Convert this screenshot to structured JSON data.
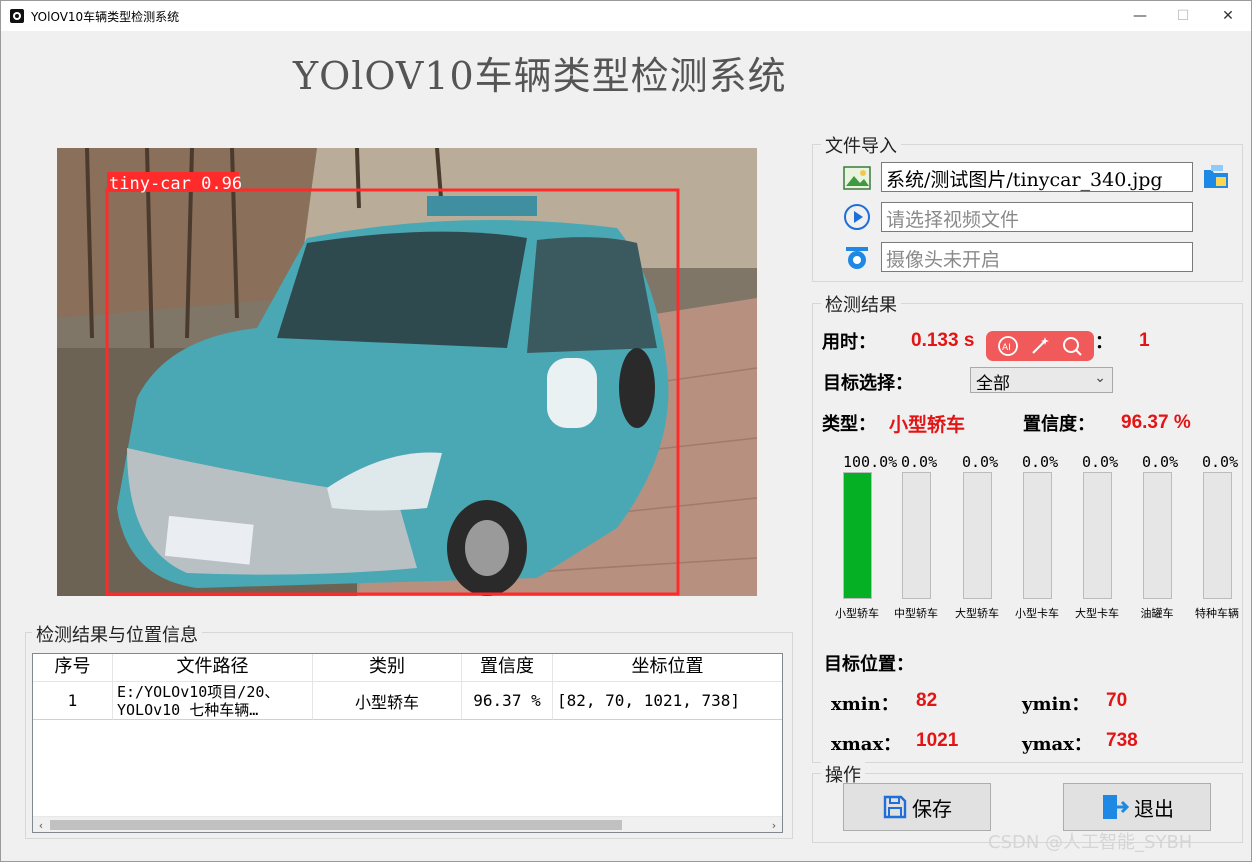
{
  "window": {
    "title": "YOlOV10车辆类型检测系统",
    "minimize_label": "—",
    "maximize_label": "☐",
    "close_label": "✕"
  },
  "app_title": "YOlOV10车辆类型检测系统",
  "detection_image": {
    "box_label": "tiny-car 0.96",
    "box_color": "#ff2b2b"
  },
  "file_import": {
    "title": "文件导入",
    "image_path": "系统/测试图片/tinycar_340.jpg",
    "video_placeholder": "请选择视频文件",
    "camera_placeholder": "摄像头未开启"
  },
  "results": {
    "title": "检测结果",
    "time_label": "用时：",
    "time_value": "0.133 s",
    "count_label": "目标数目：",
    "count_value": "1",
    "target_select_label": "目标选择：",
    "target_select_value": "全部",
    "type_label": "类型：",
    "type_value": "小型轿车",
    "conf_label": "置信度：",
    "conf_value": "96.37 %",
    "bars": [
      {
        "label": "小型轿车",
        "pct_text": "100.0%",
        "pct": 100
      },
      {
        "label": "中型轿车",
        "pct_text": "0.0%",
        "pct": 0
      },
      {
        "label": "大型轿车",
        "pct_text": "0.0%",
        "pct": 0
      },
      {
        "label": "小型卡车",
        "pct_text": "0.0%",
        "pct": 0
      },
      {
        "label": "大型卡车",
        "pct_text": "0.0%",
        "pct": 0
      },
      {
        "label": "油罐车",
        "pct_text": "0.0%",
        "pct": 0
      },
      {
        "label": "特种车辆",
        "pct_text": "0.0%",
        "pct": 0
      }
    ],
    "position_title": "目标位置：",
    "xmin_label": "xmin：",
    "xmin_value": "82",
    "ymin_label": "ymin：",
    "ymin_value": "70",
    "xmax_label": "xmax：",
    "xmax_value": "1021",
    "ymax_label": "ymax：",
    "ymax_value": "738",
    "bar_color": "#06b025"
  },
  "operations": {
    "title": "操作",
    "save_label": "保存",
    "exit_label": "退出"
  },
  "table": {
    "title": "检测结果与位置信息",
    "headers": [
      "序号",
      "文件路径",
      "类别",
      "置信度",
      "坐标位置"
    ],
    "rows": [
      {
        "index": "1",
        "path_line1": "E:/YOLOv10项目/20、",
        "path_line2": "YOLOv10 七种车辆…",
        "category": "小型轿车",
        "confidence": "96.37 %",
        "coords": "[82, 70, 1021, 738]"
      }
    ]
  },
  "watermark": "CSDN @人工智能_SYBH"
}
